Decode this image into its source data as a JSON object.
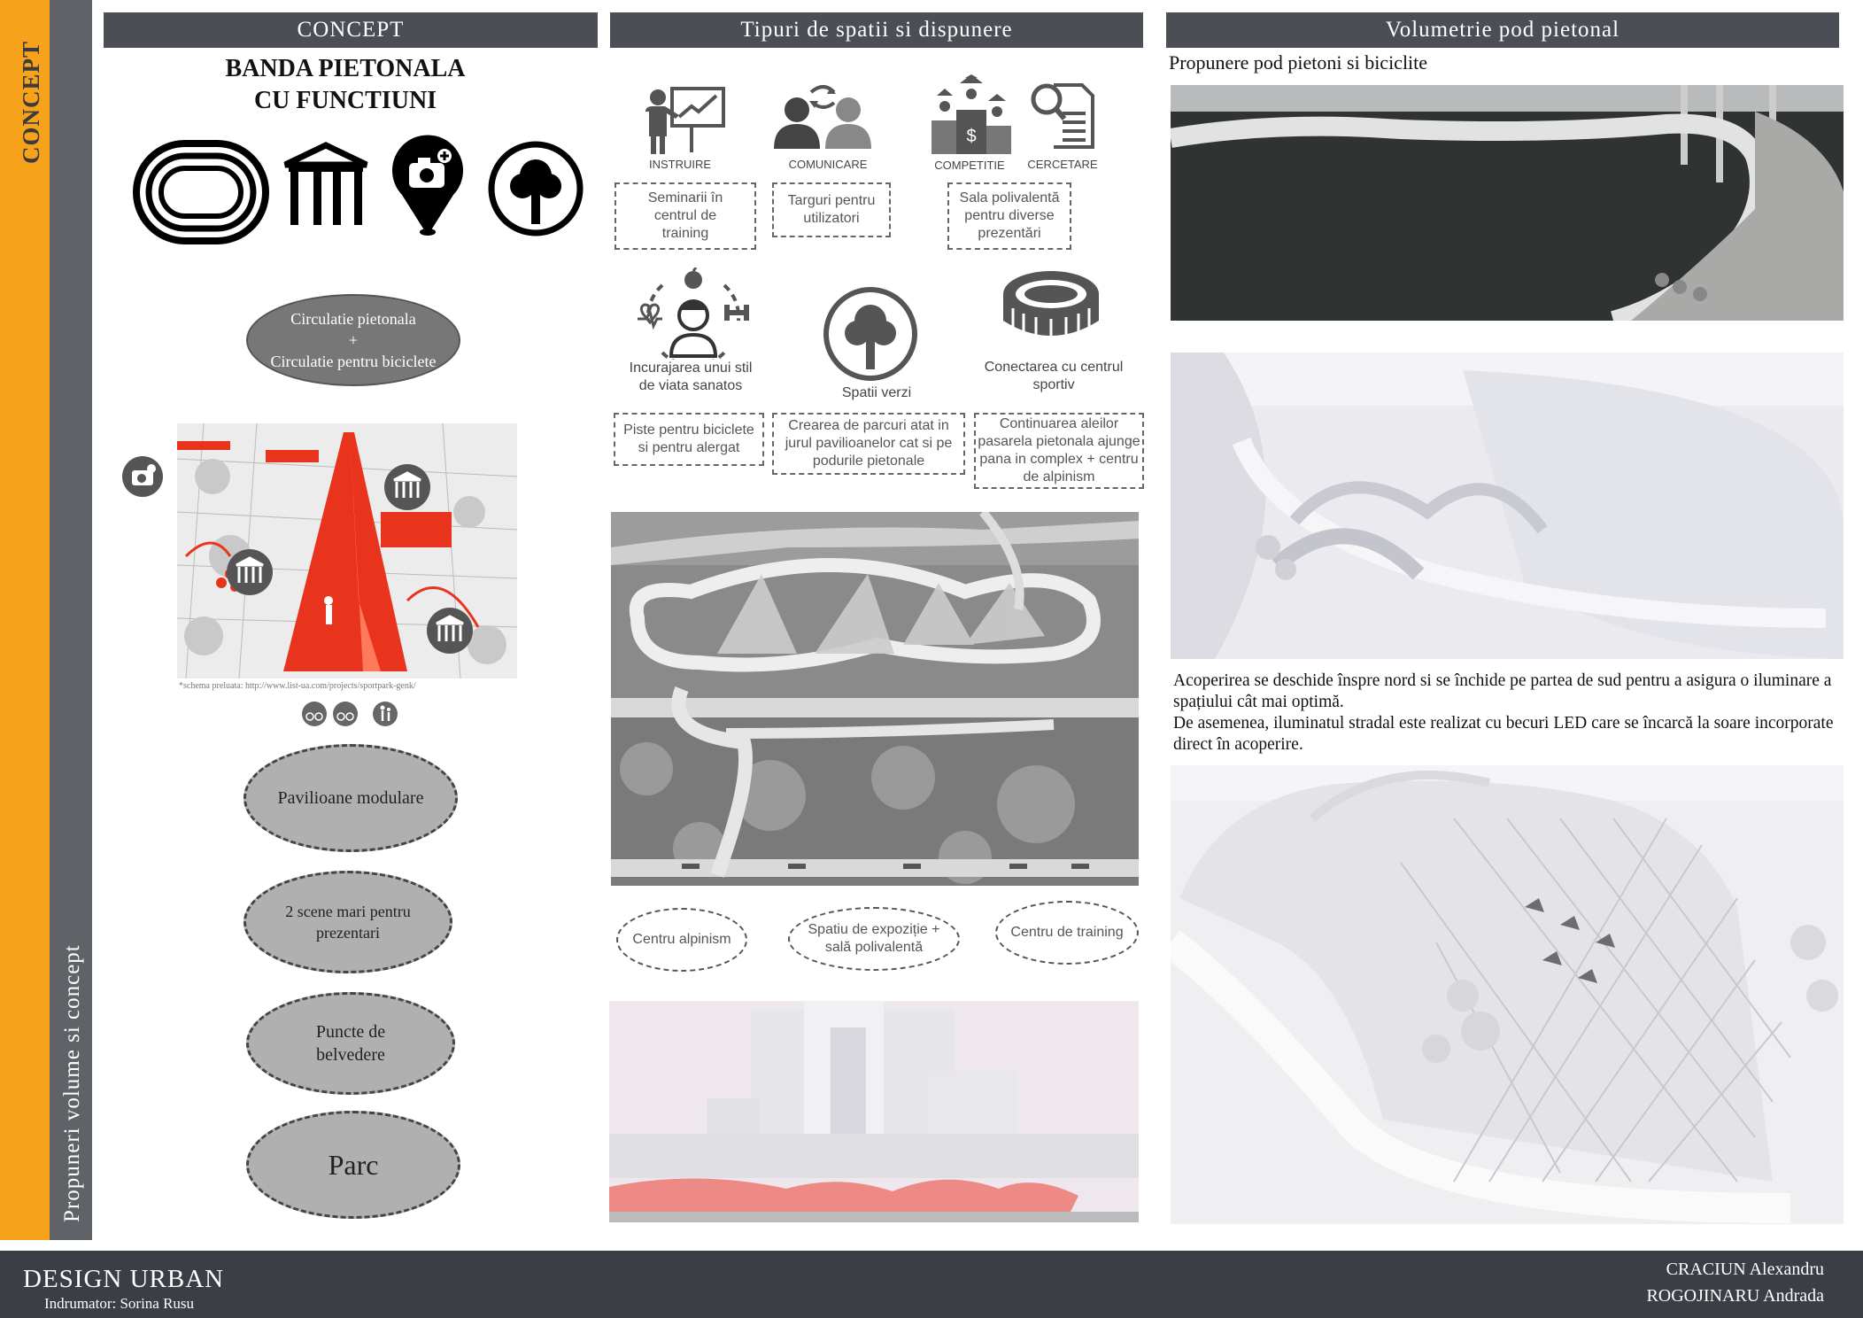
{
  "sidebar": {
    "concept_vertical": "CONCEPT",
    "propuneri_vertical": "Propuneri volume si concept"
  },
  "col1": {
    "header": "CONCEPT",
    "title_line1": "BANDA PIETONALA",
    "title_line2": "CU FUNCTIUNI",
    "circulatie_line1": "Circulatie pietonala",
    "circulatie_plus": "+",
    "circulatie_line2": "Circulatie pentru biciclete",
    "schema_caption": "*schema preluata: http://www.list-ua.com/projects/sportpark-genk/",
    "ellipses": [
      "Pavilioane modulare",
      "2 scene mari pentru prezentari",
      "Puncte de belvedere",
      "Parc"
    ]
  },
  "col2": {
    "header": "Tipuri de spatii si dispunere",
    "icons": [
      {
        "label": "INSTRUIRE",
        "icon": "presentation-icon"
      },
      {
        "label": "COMUNICARE",
        "icon": "communication-icon"
      },
      {
        "label": "COMPETITIE",
        "icon": "podium-icon"
      },
      {
        "label": "CERCETARE",
        "icon": "research-icon"
      }
    ],
    "boxes_row1": [
      "Seminarii în centrul de training",
      "Targuri pentru utilizatori",
      "Sala polivalentă pentru diverse prezentări"
    ],
    "mid_labels": [
      "Incurajarea unui stil de viata sanatos",
      "Spatii verzi",
      "Conectarea cu centrul sportiv"
    ],
    "boxes_row2": [
      "Piste pentru biciclete si pentru alergat",
      "Crearea de parcuri atat in jurul pavilioanelor cat si pe podurile pietonale",
      "Continuarea aleilor pasarela pietonala ajunge pana in complex + centru de alpinism"
    ],
    "ellipses": [
      "Centru alpinism",
      "Spatiu de expoziție + sală polivalentă",
      "Centru de training"
    ]
  },
  "col3": {
    "header": "Volumetrie pod pietonal",
    "subtitle": "Propunere pod pietoni si biciclite",
    "para1": "Acoperirea se deschide înspre nord si se închide pe partea de sud pentru a asigura o iluminare a spațiului cât mai optimă.",
    "para2": "De asemenea, iluminatul stradal este realizat cu becuri LED care se încarcă la soare incorporate direct în acoperire."
  },
  "footer": {
    "title": "DESIGN URBAN",
    "sub": "Indrumator: Sorina Rusu",
    "author1": "CRACIUN Alexandru",
    "author2": "ROGOJINARU Andrada"
  },
  "colors": {
    "orange": "#f6a21b",
    "strip_gray": "#5f6266",
    "header": "#4b4e54",
    "footer": "#3b3e45",
    "accent_red": "#e8341c"
  }
}
